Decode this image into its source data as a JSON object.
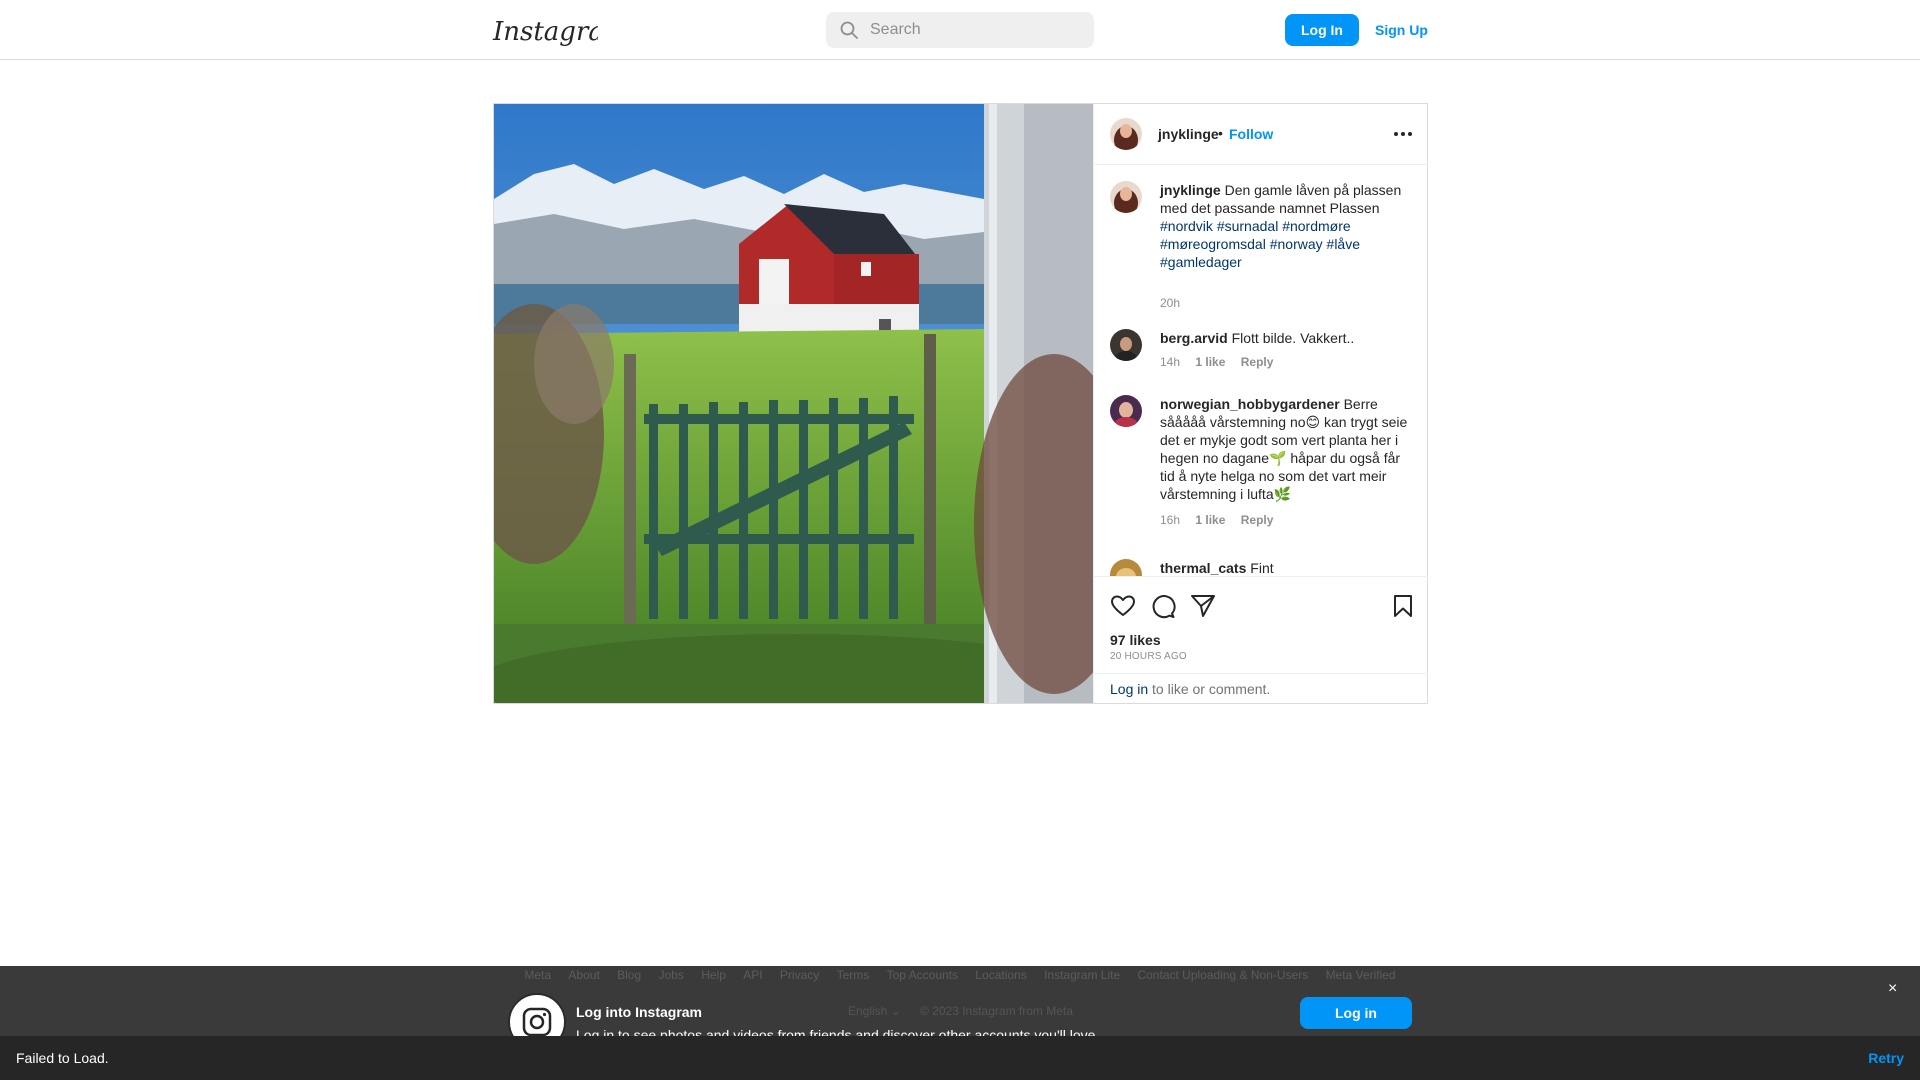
{
  "nav": {
    "logo_text": "Instagram",
    "search_placeholder": "Search",
    "login_label": "Log In",
    "signup_label": "Sign Up"
  },
  "post": {
    "author": "jnyklinge",
    "separator": "•",
    "follow_label": "Follow",
    "caption": {
      "user": "jnyklinge",
      "text": "Den gamle låven på plassen med det passande namnet Plassen",
      "hashtags": [
        "#nordvik",
        "#surnadal",
        "#nordmøre",
        "#møreogromsdal",
        "#norway",
        "#låve",
        "#gamledager"
      ],
      "time": "20h"
    },
    "comments": [
      {
        "user": "berg.arvid",
        "text": "Flott bilde. Vakkert..",
        "time": "14h",
        "likes": "1 like",
        "reply": "Reply"
      },
      {
        "user": "norwegian_hobbygardener",
        "text": "Berre sååååå vårstemning no😊 kan trygt seie det er mykje godt som vert planta her i hegen no dagane🌱 håpar du også får tid å nyte helga no som det vart meir vårstemning i lufta🌿",
        "time": "16h",
        "likes": "1 like",
        "reply": "Reply"
      },
      {
        "user": "thermal_cats",
        "text": "Fint"
      }
    ],
    "likes": "97 likes",
    "time_ago": "20 HOURS AGO",
    "login_prompt": {
      "link": "Log in",
      "rest": " to like or comment."
    }
  },
  "overlay": {
    "footer_links": [
      "Meta",
      "About",
      "Blog",
      "Jobs",
      "Help",
      "API",
      "Privacy",
      "Terms",
      "Top Accounts",
      "Locations",
      "Instagram Lite",
      "Contact Uploading & Non-Users",
      "Meta Verified"
    ],
    "title": "Log into Instagram",
    "subtitle": "Log in to see photos and videos from friends and discover other accounts you'll love.",
    "language": "English",
    "copyright": "© 2023 Instagram from Meta",
    "login_label": "Log in",
    "close": "×"
  },
  "snackbar": {
    "message": "Failed to Load.",
    "action": "Retry"
  },
  "colors": {
    "accent": "#0095f6",
    "link": "#00376b",
    "muted": "#8e8e8e",
    "border": "#dbdbdb"
  },
  "icons": [
    "search-icon",
    "more-options-icon",
    "heart-icon",
    "comment-icon",
    "share-icon",
    "bookmark-icon",
    "instagram-icon",
    "chevron-down-icon"
  ]
}
